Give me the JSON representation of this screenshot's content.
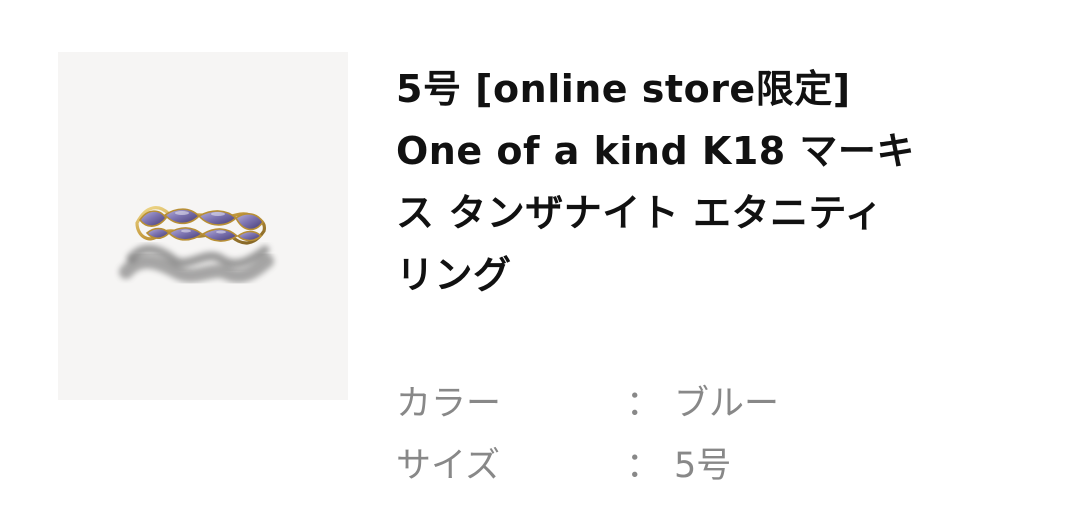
{
  "product": {
    "image_alt": "Marquise tanzanite eternity ring",
    "title_lines": [
      "5号 [online store限定]",
      "One of a kind K18 マーキ",
      "ス タンザナイト エタニティ",
      "リング"
    ],
    "specs": [
      {
        "label": "カラー",
        "separator": "：",
        "value": "ブルー"
      },
      {
        "label": "サイズ",
        "separator": "：",
        "value": "5号"
      }
    ]
  },
  "colors": {
    "background": "#ffffff",
    "image_background": "#f6f5f4",
    "title": "#111111",
    "spec_text": "#888888",
    "gold": "#c6a24f",
    "tanzanite": "#7770a8"
  },
  "icons": {
    "product_image": "ring-image"
  }
}
